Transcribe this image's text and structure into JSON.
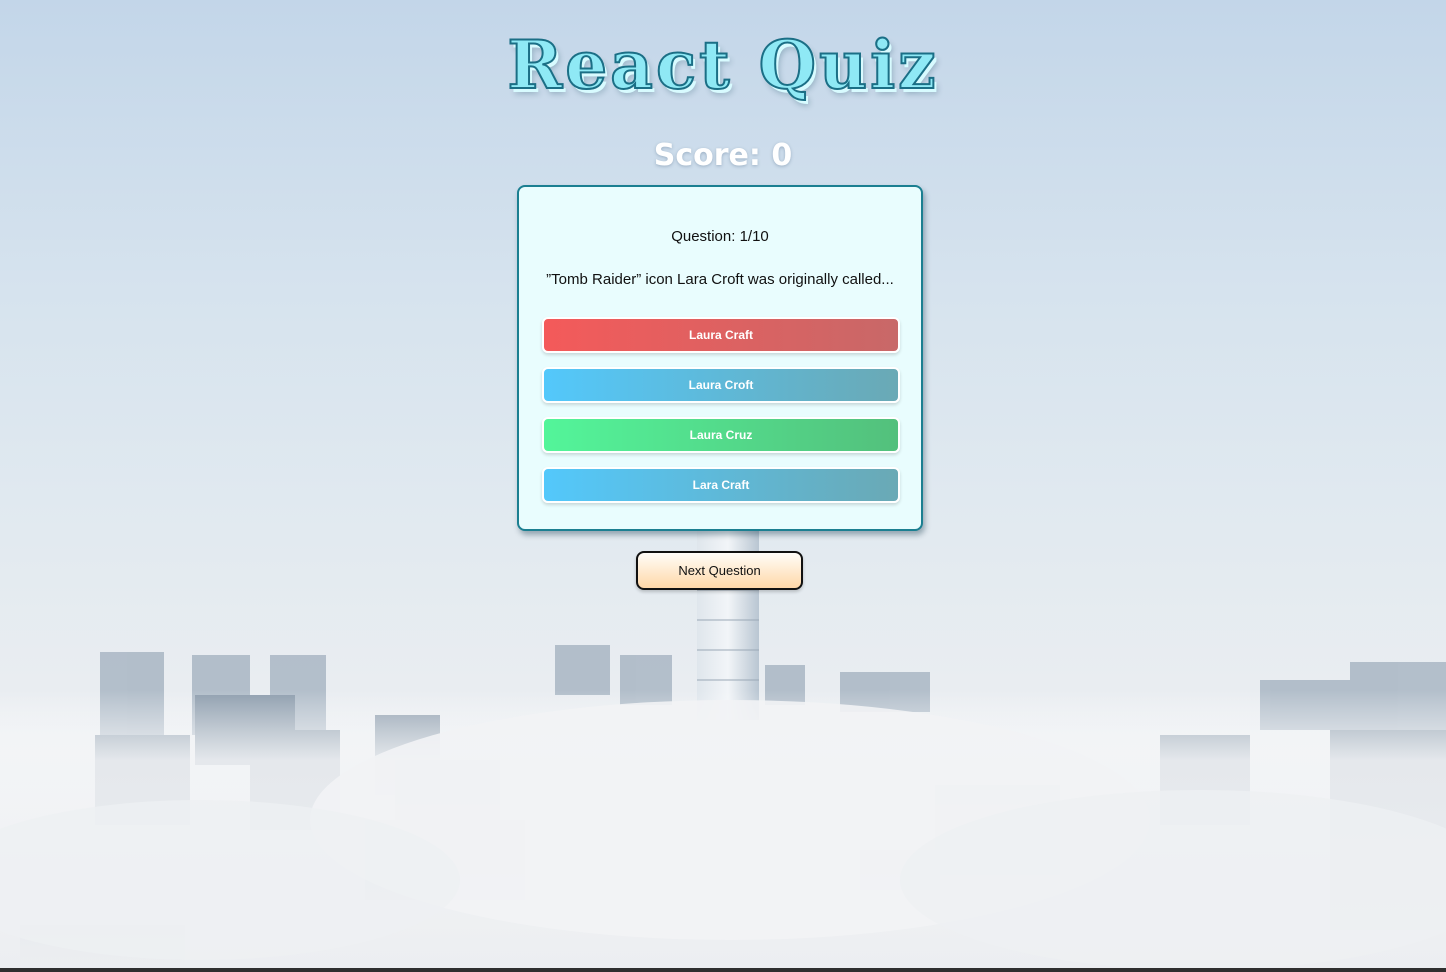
{
  "header": {
    "title": "React Quiz",
    "score_text": "Score: 0"
  },
  "quiz": {
    "question_number": "Question: 1/10",
    "question_text": "”Tomb Raider” icon Lara Croft was originally called...",
    "answers": [
      {
        "label": "Laura Craft"
      },
      {
        "label": "Laura Croft"
      },
      {
        "label": "Laura Cruz"
      },
      {
        "label": "Lara Craft"
      }
    ]
  },
  "controls": {
    "next_label": "Next Question"
  },
  "colors": {
    "title_fill": "#8fe9f5",
    "title_outline": "#1b6f86",
    "card_bg": "#e9fdfe",
    "card_border": "#1b7f91",
    "answer_red": "#f45a5a",
    "answer_blue": "#53c8fb",
    "answer_green": "#53f59a",
    "next_button": "#ffd8a8"
  }
}
